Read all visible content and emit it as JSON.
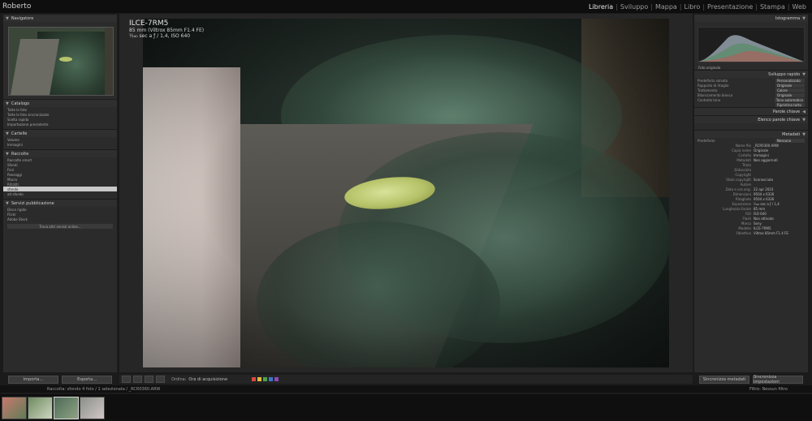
{
  "app": {
    "user": "Roberto",
    "modules": [
      {
        "label": "Libreria",
        "active": true
      },
      {
        "label": "Sviluppo",
        "active": false
      },
      {
        "label": "Mappa",
        "active": false
      },
      {
        "label": "Libro",
        "active": false
      },
      {
        "label": "Presentazione",
        "active": false
      },
      {
        "label": "Stampa",
        "active": false
      },
      {
        "label": "Web",
        "active": false
      }
    ],
    "separator": "|"
  },
  "left": {
    "navigator": {
      "title": "Navigatore"
    },
    "catalog": {
      "title": "Catalogo",
      "items": [
        "Tutte le foto",
        "Tutte le foto sincronizzate",
        "Scelta rapida",
        "Importazione precedente"
      ]
    },
    "folders": {
      "title": "Cartelle",
      "items": [
        "Volume",
        "Immagini"
      ]
    },
    "collections": {
      "title": "Raccolte",
      "items": [
        "Raccolte smart",
        "Sfondi",
        "Fiori",
        "Paesaggi",
        "Macro",
        "Ritratti",
        "sfondo",
        "alt sfondo"
      ]
    },
    "publish": {
      "title": "Servizi pubblicazione",
      "items": [
        "Disco rigido",
        "Flickr",
        "Adobe Stock"
      ],
      "find_more": "Trova altri servizi online..."
    }
  },
  "photo": {
    "camera": "ILCE-7RM5",
    "lens": "85 mm (Viltrox 85mm F1.4 FE)",
    "exposure": "⅟₁₆₀ sec a ƒ / 1,4, ISO 640"
  },
  "toolbar": {
    "sort_label": "Ordina:",
    "sort_value": "Ora di acquisizione",
    "color_labels": [
      "#d9483b",
      "#e0b93a",
      "#4fa24a",
      "#3d76c8",
      "#8b4ab3"
    ]
  },
  "buttons": {
    "import": "Importa...",
    "export": "Esporta...",
    "sync_metadata": "Sincronizza metadati",
    "sync_settings": "Sincronizza impostazioni"
  },
  "filmbar": {
    "path": "Raccolta: sfondo   4 foto / 1 selezionata / _RCR0360.ARW",
    "filter_label": "Filtro:",
    "filter_value": "Nessun filtro"
  },
  "right": {
    "histogram": {
      "title": "Istogramma",
      "foot": "Foto originale"
    },
    "quick_develop": {
      "title": "Sviluppo rapido",
      "preset_label": "Predefinito salvato",
      "preset_value": "Personalizzato",
      "crop_label": "Rapporto di ritaglio",
      "crop_value": "Originale",
      "treatment_label": "Trattamento",
      "treatment_value": "Colore",
      "wb_label": "Bilanciamento bianco",
      "wb_value": "Originale",
      "tone_label": "Controllo tono",
      "tone_value": "Tono automatico",
      "reset": "Ripristina tutto"
    },
    "keywording": {
      "title": "Parole chiave"
    },
    "keyword_list": {
      "title": "Elenco parole chiave"
    },
    "metadata": {
      "title": "Metadati",
      "preset_label": "Predefinito",
      "preset_value": "Nessuno",
      "rows": [
        [
          "Nome file",
          "_RCR0360.ARW"
        ],
        [
          "Copia nome",
          "Originale"
        ],
        [
          "Cartella",
          "Immagini"
        ],
        [
          "Metadati",
          "Non aggiornati"
        ],
        [
          "Titolo",
          ""
        ],
        [
          "Didascalia",
          ""
        ],
        [
          "Copyright",
          ""
        ],
        [
          "Stato copyright",
          "Sconosciuto"
        ],
        [
          "Autore",
          ""
        ],
        [
          "Data e ora orig.",
          "22 apr 2023"
        ],
        [
          "Dimensioni",
          "9504 x 6336"
        ],
        [
          "Ritagliato",
          "9504 x 6336"
        ],
        [
          "Esposizione",
          "⅟₁₆₀ sec a ƒ / 1,4"
        ],
        [
          "Lunghezza focale",
          "85 mm"
        ],
        [
          "ISO",
          "ISO 640"
        ],
        [
          "Flash",
          "Non attivato"
        ],
        [
          "Marca",
          "Sony"
        ],
        [
          "Modello",
          "ILCE-7RM5"
        ],
        [
          "Obiettivo",
          "Viltrox 85mm F1.4 FE"
        ]
      ]
    }
  }
}
